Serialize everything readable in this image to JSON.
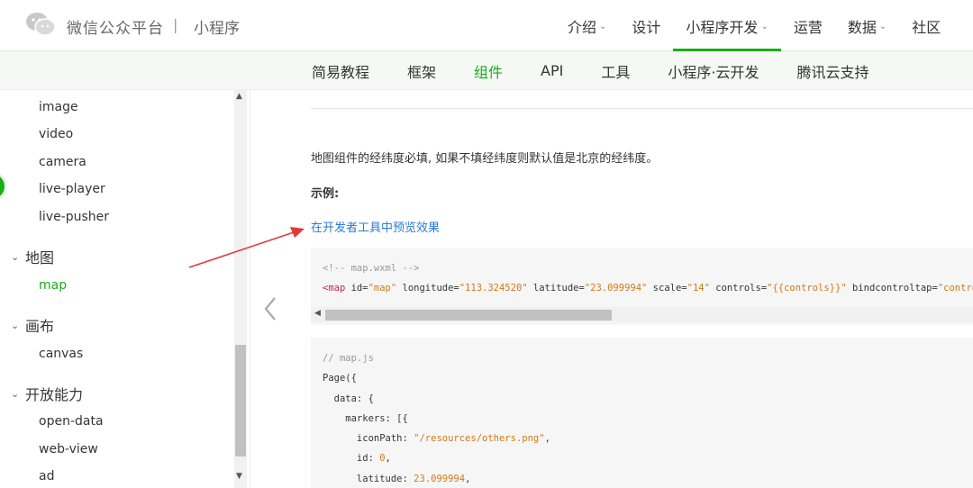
{
  "header": {
    "brand": "微信公众平台",
    "separator": "|",
    "brand_sub": "小程序",
    "nav": [
      {
        "label": "介绍",
        "caret": true
      },
      {
        "label": "设计",
        "caret": false
      },
      {
        "label": "小程序开发",
        "caret": true,
        "active": true
      },
      {
        "label": "运营",
        "caret": false
      },
      {
        "label": "数据",
        "caret": true
      },
      {
        "label": "社区",
        "caret": false
      }
    ]
  },
  "subnav": [
    "简易教程",
    "框架",
    "组件",
    "API",
    "工具",
    "小程序·云开发",
    "腾讯云支持"
  ],
  "sidebar": {
    "items": [
      {
        "label": "image"
      },
      {
        "label": "video"
      },
      {
        "label": "camera"
      },
      {
        "label": "live-player"
      },
      {
        "label": "live-pusher"
      }
    ],
    "group_map": "地图",
    "item_map": "map",
    "group_canvas": "画布",
    "item_canvas": "canvas",
    "group_open": "开放能力",
    "items_open": [
      {
        "label": "open-data"
      },
      {
        "label": "web-view"
      },
      {
        "label": "ad"
      }
    ]
  },
  "content": {
    "paragraph": "地图组件的经纬度必填, 如果不填经纬度则默认值是北京的经纬度。",
    "example_label": "示例:",
    "preview_link": "在开发者工具中预览效果",
    "code1": {
      "comment": "<!-- map.wxml -->",
      "tag_open": "<map ",
      "attr_id": "id=",
      "val_id": "\"map\"",
      "attr_lng": " longitude=",
      "val_lng": "\"113.324520\"",
      "attr_lat": " latitude=",
      "val_lat": "\"23.099994\"",
      "attr_scale": " scale=",
      "val_scale": "\"14\"",
      "attr_controls": " controls=",
      "val_controls": "\"{{controls}}\"",
      "attr_bind": " bindcontroltap=",
      "val_bind": "\"controltap\""
    },
    "code2": {
      "line1": "// map.js",
      "line2": "Page({",
      "line3": "  data: {",
      "line4": "    markers: [{",
      "line5_key": "      iconPath: ",
      "line5_val": "\"/resources/others.png\"",
      "line5_end": ",",
      "line6_key": "      id: ",
      "line6_val": "0",
      "line6_end": ",",
      "line7_key": "      latitude: ",
      "line7_val": "23.099994",
      "line7_end": ","
    }
  },
  "colors": {
    "accent": "#1aad19",
    "link": "#2b7bd6",
    "annotation_arrow": "#e53935"
  }
}
